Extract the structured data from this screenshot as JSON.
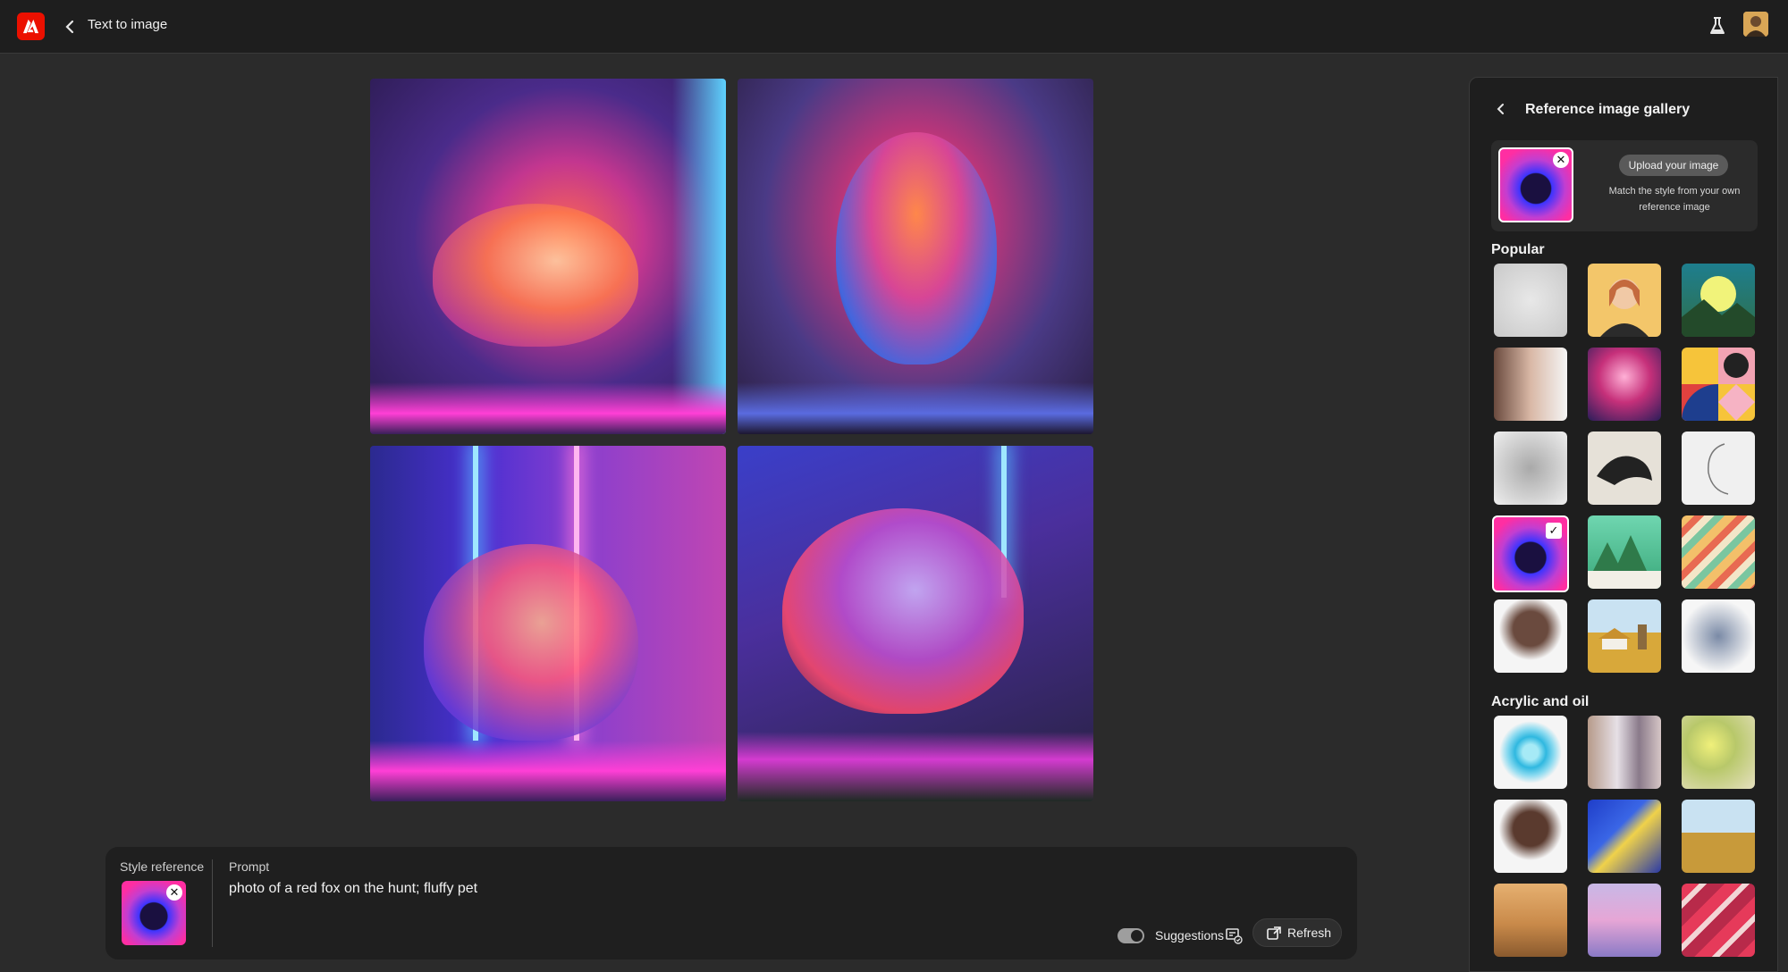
{
  "header": {
    "title": "Text to image",
    "colors": {
      "logo": "#eb1000",
      "bar": "#1e1e1e"
    }
  },
  "images": [
    {
      "label": "fox-image-1"
    },
    {
      "label": "fox-image-2"
    },
    {
      "label": "fox-image-3"
    },
    {
      "label": "fox-image-4"
    }
  ],
  "prompt_bar": {
    "style_reference_label": "Style reference",
    "prompt_label": "Prompt",
    "prompt_text": "photo of a red fox on the hunt; fluffy pet",
    "suggestions_label": "Suggestions",
    "refresh_label": "Refresh"
  },
  "panel": {
    "title": "Reference image gallery",
    "upload_button": "Upload your image",
    "upload_description": "Match the style from your own reference image",
    "sections": {
      "popular": "Popular",
      "acrylic": "Acrylic and oil"
    }
  }
}
